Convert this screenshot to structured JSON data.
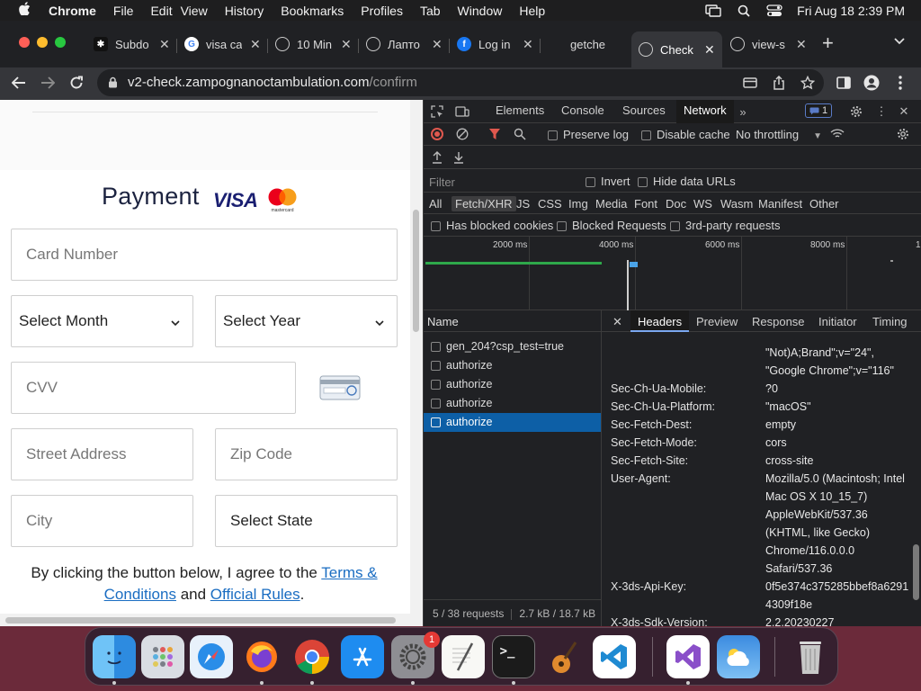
{
  "menubar": {
    "app": "Chrome",
    "items": [
      "File",
      "Edit",
      "View",
      "History",
      "Bookmarks",
      "Profiles",
      "Tab",
      "Window",
      "Help"
    ],
    "clock": "Fri Aug 18  2:39 PM"
  },
  "tabs": [
    {
      "title": "Subdo",
      "icon": "subdomain-favicon"
    },
    {
      "title": "visa ca",
      "icon": "google-favicon"
    },
    {
      "title": "10 Min",
      "icon": "globe-favicon"
    },
    {
      "title": "Лапто",
      "icon": "globe-favicon"
    },
    {
      "title": "Log in",
      "icon": "facebook-favicon"
    },
    {
      "title": "getche",
      "icon": "none"
    },
    {
      "title": "Check",
      "icon": "globe-favicon",
      "active": true
    },
    {
      "title": "view-s",
      "icon": "globe-favicon"
    }
  ],
  "address": {
    "host": "v2-check.zampognanoctambulation.com",
    "path": "/confirm"
  },
  "page": {
    "title": "Payment",
    "visa": "VISA",
    "mastercard": "mastercard",
    "card_placeholder": "Card Number",
    "month": "Select Month",
    "year": "Select Year",
    "cvv_placeholder": "CVV",
    "street_placeholder": "Street Address",
    "zip_placeholder": "Zip Code",
    "city_placeholder": "City",
    "state": "Select State",
    "agree_prefix": "By clicking the button below, I agree to the ",
    "terms": "Terms & Conditions",
    "and": " and ",
    "rules": "Official Rules",
    "period": "."
  },
  "devtools": {
    "tabs": [
      "Elements",
      "Console",
      "Sources",
      "Network"
    ],
    "active_tab": "Network",
    "issues_count": "1",
    "preserve_log": "Preserve log",
    "disable_cache": "Disable cache",
    "throttling": "No throttling",
    "filter_placeholder": "Filter",
    "invert": "Invert",
    "hide_data_urls": "Hide data URLs",
    "type_filters": [
      "All",
      "Fetch/XHR",
      "JS",
      "CSS",
      "Img",
      "Media",
      "Font",
      "Doc",
      "WS",
      "Wasm",
      "Manifest",
      "Other"
    ],
    "selected_type": "Fetch/XHR",
    "blocked_cookies": "Has blocked cookies",
    "blocked_requests": "Blocked Requests",
    "third_party": "3rd-party requests",
    "ticks": [
      "2000 ms",
      "4000 ms",
      "6000 ms",
      "8000 ms",
      "1"
    ],
    "name_header": "Name",
    "requests": [
      "gen_204?csp_test=true",
      "authorize",
      "authorize",
      "authorize",
      "authorize"
    ],
    "selected_request": 4,
    "footer_requests": "5 / 38 requests",
    "footer_size": "2.7 kB / 18.7 kB",
    "detail_tabs": [
      "Headers",
      "Preview",
      "Response",
      "Initiator",
      "Timing"
    ],
    "active_detail_tab": "Headers",
    "headers": [
      {
        "key": "",
        "value": "\"Not)A;Brand\";v=\"24\","
      },
      {
        "key": "",
        "value": "\"Google Chrome\";v=\"116\""
      },
      {
        "key": "Sec-Ch-Ua-Mobile:",
        "value": "?0"
      },
      {
        "key": "Sec-Ch-Ua-Platform:",
        "value": "\"macOS\""
      },
      {
        "key": "Sec-Fetch-Dest:",
        "value": "empty"
      },
      {
        "key": "Sec-Fetch-Mode:",
        "value": "cors"
      },
      {
        "key": "Sec-Fetch-Site:",
        "value": "cross-site"
      },
      {
        "key": "User-Agent:",
        "value": "Mozilla/5.0 (Macintosh; Intel"
      },
      {
        "key": "",
        "value": "Mac OS X 10_15_7)"
      },
      {
        "key": "",
        "value": "AppleWebKit/537.36"
      },
      {
        "key": "",
        "value": "(KHTML, like Gecko)"
      },
      {
        "key": "",
        "value": "Chrome/116.0.0.0"
      },
      {
        "key": "",
        "value": "Safari/537.36"
      },
      {
        "key": "X-3ds-Api-Key:",
        "value": "0f5e374c375285bbef8a6291"
      },
      {
        "key": "",
        "value": "4309f18e"
      },
      {
        "key": "X-3ds-Sdk-Version:",
        "value": "2.2.20230227"
      }
    ]
  },
  "dock": {
    "apps": [
      "finder",
      "launchpad",
      "safari",
      "firefox",
      "chrome",
      "app-store",
      "system-settings",
      "textedit",
      "terminal",
      "garageband",
      "vscode",
      "visual-studio",
      "weather",
      "trash"
    ],
    "settings_badge": "1"
  },
  "colors": {
    "accent_blue": "#0d5fa6",
    "link": "#1a6dc2",
    "record_red": "#e0584e"
  }
}
